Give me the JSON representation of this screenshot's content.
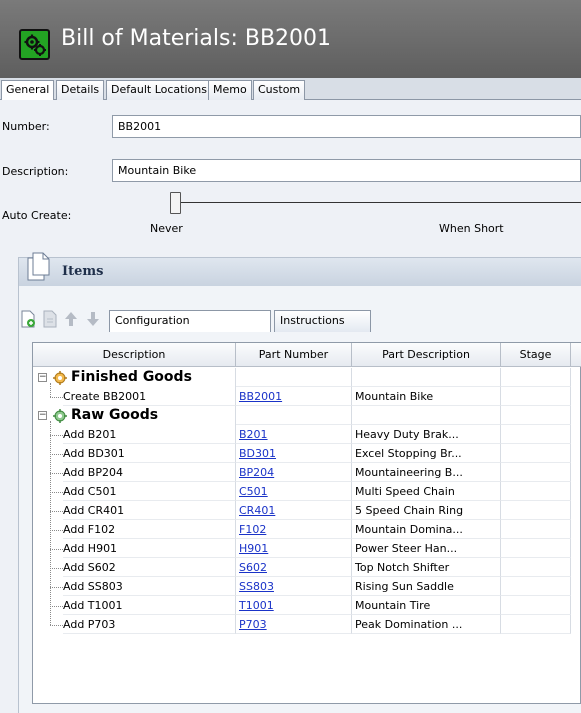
{
  "window": {
    "title": "Bill of Materials: BB2001",
    "app_icon": "gears-icon"
  },
  "tabs": [
    {
      "label": "General",
      "active": true
    },
    {
      "label": "Details"
    },
    {
      "label": "Default Locations"
    },
    {
      "label": "Memo"
    },
    {
      "label": "Custom"
    }
  ],
  "form": {
    "number_label": "Number:",
    "number_value": "BB2001",
    "description_label": "Description:",
    "description_value": "Mountain Bike",
    "auto_create_label": "Auto Create:",
    "auto_create_options": [
      "Never",
      "When Short"
    ],
    "auto_create_selected": "Never"
  },
  "items": {
    "title": "Items",
    "toolbar_icons": [
      "add-item-icon",
      "delete-item-icon",
      "move-up-icon",
      "move-down-icon"
    ],
    "subtabs": [
      "Configuration",
      "Instructions"
    ],
    "active_subtab": "Configuration",
    "columns": [
      "Description",
      "Part Number",
      "Part Description",
      "Stage"
    ],
    "groups": [
      {
        "label": "Finished Goods",
        "icon": "finished-goods-icon",
        "rows": [
          {
            "description": "Create BB2001",
            "part_number": "BB2001",
            "part_description": "Mountain Bike",
            "stage": ""
          }
        ]
      },
      {
        "label": "Raw Goods",
        "icon": "raw-goods-icon",
        "rows": [
          {
            "description": "Add B201",
            "part_number": "B201",
            "part_description": "Heavy Duty Brak...",
            "stage": ""
          },
          {
            "description": "Add BD301",
            "part_number": "BD301",
            "part_description": "Excel Stopping Br...",
            "stage": ""
          },
          {
            "description": "Add BP204",
            "part_number": "BP204",
            "part_description": "Mountaineering B...",
            "stage": ""
          },
          {
            "description": "Add C501",
            "part_number": "C501",
            "part_description": "Multi Speed Chain",
            "stage": ""
          },
          {
            "description": "Add CR401",
            "part_number": "CR401",
            "part_description": "5 Speed Chain Ring",
            "stage": ""
          },
          {
            "description": "Add F102",
            "part_number": "F102",
            "part_description": "Mountain Domina...",
            "stage": ""
          },
          {
            "description": "Add H901",
            "part_number": "H901",
            "part_description": "Power Steer Han...",
            "stage": ""
          },
          {
            "description": "Add S602",
            "part_number": "S602",
            "part_description": "Top Notch Shifter",
            "stage": ""
          },
          {
            "description": "Add SS803",
            "part_number": "SS803",
            "part_description": "Rising Sun Saddle",
            "stage": ""
          },
          {
            "description": "Add T1001",
            "part_number": "T1001",
            "part_description": "Mountain Tire",
            "stage": ""
          },
          {
            "description": "Add P703",
            "part_number": "P703",
            "part_description": "Peak Domination ...",
            "stage": ""
          }
        ]
      }
    ]
  }
}
